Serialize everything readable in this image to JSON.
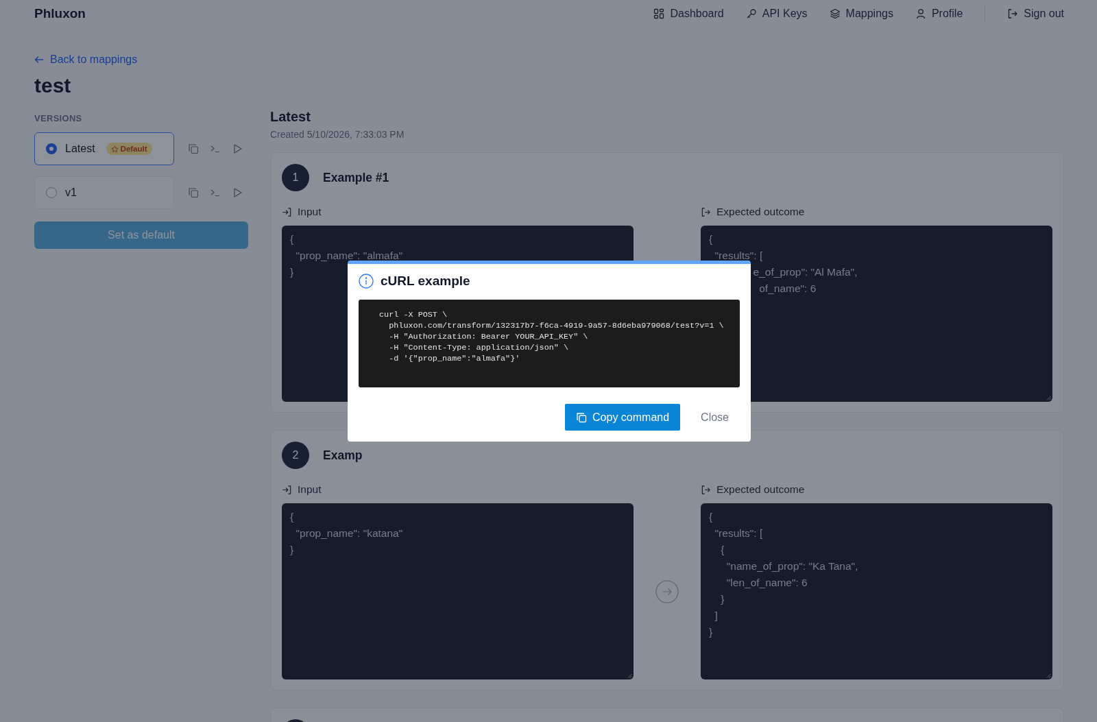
{
  "header": {
    "brand": "Phluxon",
    "nav": [
      {
        "label": "Dashboard"
      },
      {
        "label": "API Keys"
      },
      {
        "label": "Mappings"
      },
      {
        "label": "Profile"
      }
    ],
    "sign_out": "Sign out"
  },
  "back_link": "Back to mappings",
  "title": "test",
  "versions": {
    "heading": "VERSIONS",
    "items": [
      {
        "name": "Latest",
        "selected": true,
        "badge": "Default"
      },
      {
        "name": "v1",
        "selected": false
      }
    ],
    "set_default_button": {
      "label": "Set as default",
      "disabled": true
    }
  },
  "detail": {
    "title": "Latest",
    "created": "Created 5/10/2026, 7:33:03 PM",
    "examples": [
      {
        "number": "1",
        "title": "Example #1",
        "input_label": "Input",
        "input_lines": [
          "{",
          "  \"prop_name\": \"almafa\"",
          "}"
        ],
        "output_label": "Expected outcome",
        "output_lines": [
          "{",
          "  \"results\": [",
          "               e_of_prop\": \"Al Mafa\",",
          "                 of_name\": 6"
        ],
        "arrow": false
      },
      {
        "number": "2",
        "title": "Examp",
        "input_label": "Input",
        "input_lines": [
          "{",
          "  \"prop_name\": \"katana\"",
          "}"
        ],
        "output_label": "Expected outcome",
        "output_lines": [
          "{",
          "  \"results\": [",
          "    {",
          "      \"name_of_prop\": \"Ka Tana\",",
          "      \"len_of_name\": 6",
          "    }",
          "  ]",
          "}"
        ],
        "arrow": true
      }
    ],
    "next_card_visible": true
  },
  "modal": {
    "title": "cURL example",
    "code_lines": [
      "curl -X POST \\",
      "  phluxon.com/transform/132317b7-f6ca-4919-9a57-8d6eba979068/test?v=1 \\",
      "  -H \"Authorization: Bearer YOUR_API_KEY\" \\",
      "  -H \"Content-Type: application/json\" \\",
      "  -d '{\"prop_name\":\"almafa\"}'"
    ],
    "copy_button": "Copy command",
    "close_button": "Close"
  }
}
